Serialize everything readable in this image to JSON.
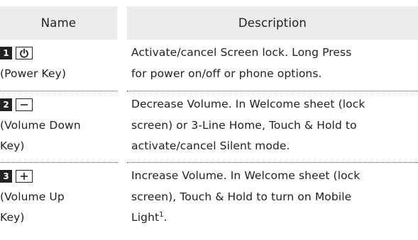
{
  "header": {
    "name": "Name",
    "description": "Description"
  },
  "rows": [
    {
      "number": "1",
      "key_icon": "power-icon",
      "name_lines": [
        "(Power Key)"
      ],
      "desc_lines": [
        "Activate/cancel Screen lock. Long Press",
        "for power on/off or phone options."
      ]
    },
    {
      "number": "2",
      "key_icon": "minus-icon",
      "name_lines": [
        "(Volume Down",
        "Key)"
      ],
      "desc_lines": [
        "Decrease Volume. In Welcome sheet (lock",
        "screen) or 3-Line Home, Touch & Hold to",
        "activate/cancel Silent mode."
      ]
    },
    {
      "number": "3",
      "key_icon": "plus-icon",
      "name_lines": [
        "(Volume Up",
        "Key)"
      ],
      "desc_lines": [
        "Increase Volume. In Welcome sheet (lock",
        "screen), Touch & Hold to turn on Mobile",
        "Light"
      ],
      "footnote_mark": "1",
      "desc_end": "."
    }
  ],
  "colors": {
    "header_bg": "#ebebeb",
    "text": "#222222",
    "badge_bg": "#222222",
    "separator": "#555555"
  }
}
